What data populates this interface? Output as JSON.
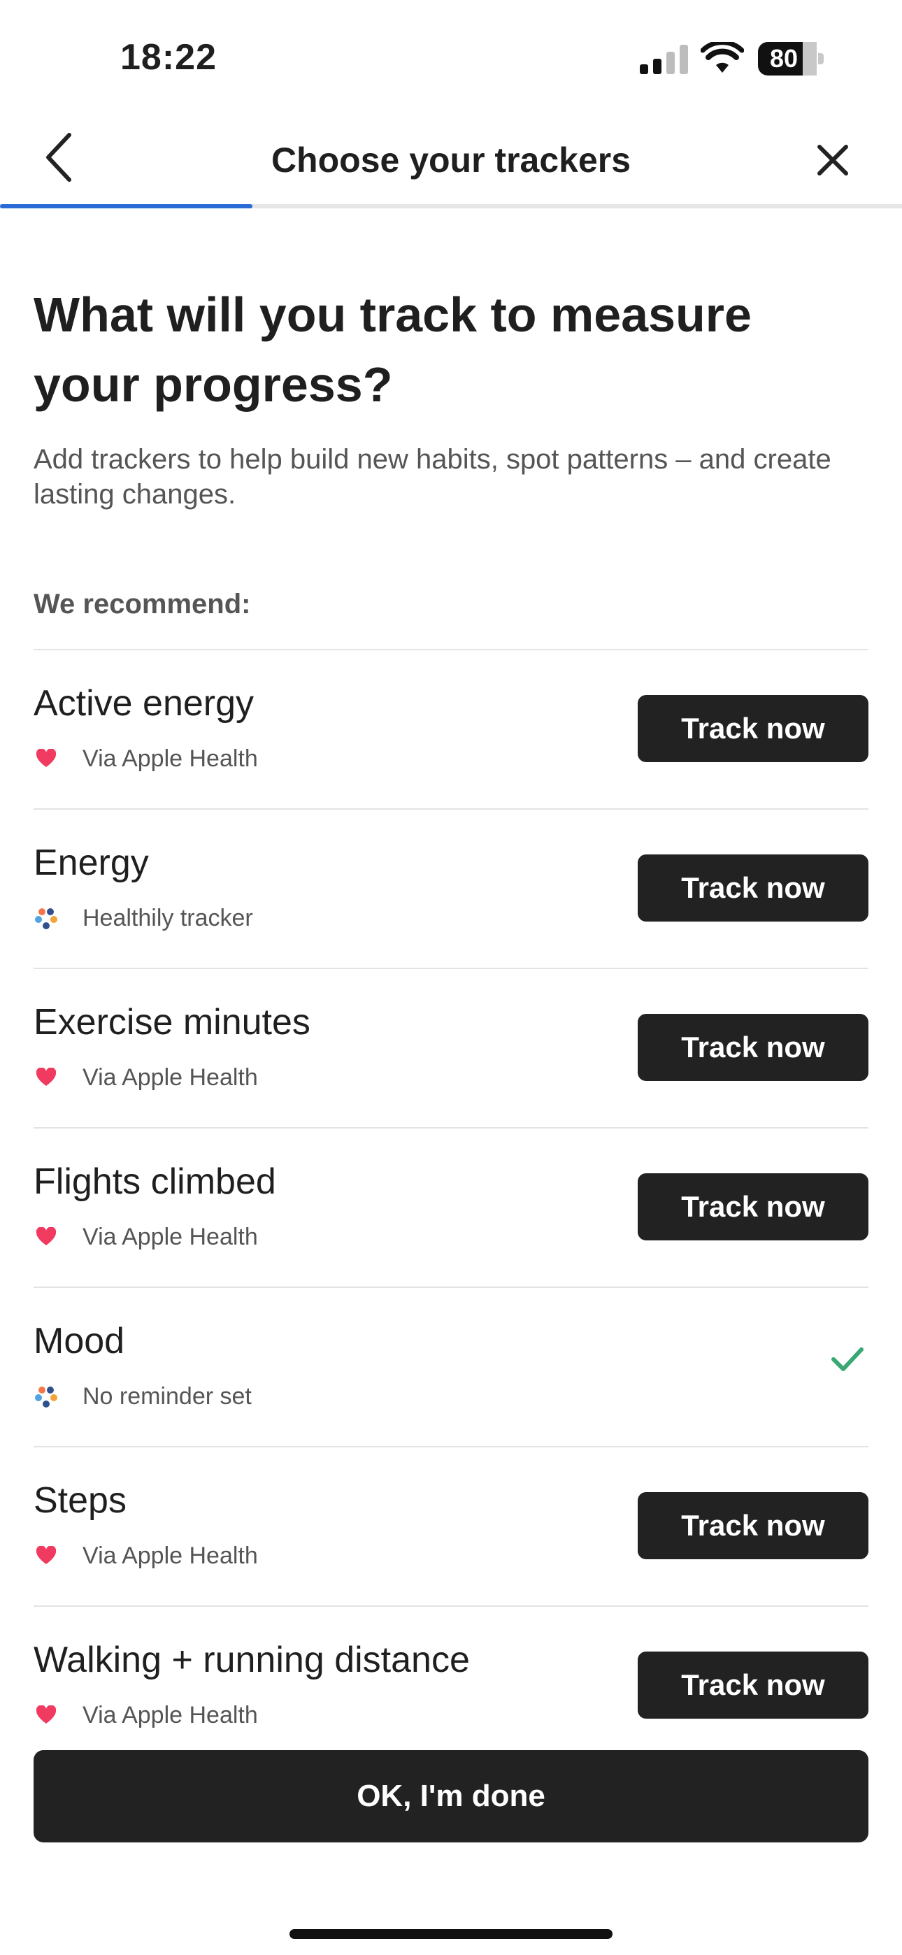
{
  "status_bar": {
    "time": "18:22",
    "battery": "80",
    "icons": [
      "signal-icon",
      "wifi-icon",
      "battery-icon"
    ]
  },
  "nav": {
    "title": "Choose your trackers",
    "back_icon": "chevron-left-icon",
    "close_icon": "close-icon",
    "progress_fraction": 0.28
  },
  "headline": "What will you track to measure your progress?",
  "subtitle": "Add trackers to help build new habits, spot patterns – and create lasting changes.",
  "section_label": "We recommend:",
  "trackers": [
    {
      "name": "Active energy",
      "source": "Via Apple Health",
      "icon": "heart-icon",
      "action": "Track now",
      "tracked": false
    },
    {
      "name": "Energy",
      "source": "Healthily tracker",
      "icon": "healthily-icon",
      "action": "Track now",
      "tracked": false
    },
    {
      "name": "Exercise minutes",
      "source": "Via Apple Health",
      "icon": "heart-icon",
      "action": "Track now",
      "tracked": false
    },
    {
      "name": "Flights climbed",
      "source": "Via Apple Health",
      "icon": "heart-icon",
      "action": "Track now",
      "tracked": false
    },
    {
      "name": "Mood",
      "source": "No reminder set",
      "icon": "healthily-icon",
      "action": "",
      "tracked": true
    },
    {
      "name": "Steps",
      "source": "Via Apple Health",
      "icon": "heart-icon",
      "action": "Track now",
      "tracked": false
    },
    {
      "name": "Walking + running distance",
      "source": "Via Apple Health",
      "icon": "heart-icon",
      "action": "Track now",
      "tracked": false
    }
  ],
  "done_button": "OK, I'm done",
  "colors": {
    "accent": "#2a6ad6",
    "button": "#222222",
    "check": "#3aa874",
    "heart": "#f03a5f"
  }
}
